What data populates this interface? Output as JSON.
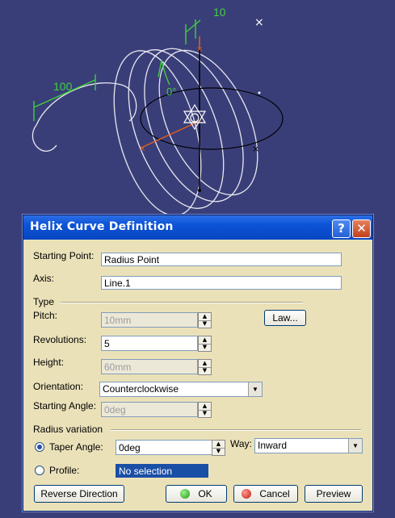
{
  "viewport": {
    "dim_pitch": "10",
    "dim_length": "100",
    "dim_angle": "0°"
  },
  "dialog": {
    "title": "Helix Curve Definition",
    "help_glyph": "?",
    "close_glyph": "✕",
    "starting_point": {
      "label": "Starting Point:",
      "value": "Radius Point"
    },
    "axis": {
      "label": "Axis:",
      "value": "Line.1"
    },
    "type_group": "Type",
    "pitch": {
      "label": "Pitch:",
      "value": "10mm"
    },
    "law_button": "Law...",
    "revolutions": {
      "label": "Revolutions:",
      "value": "5"
    },
    "height": {
      "label": "Height:",
      "value": "60mm"
    },
    "orientation": {
      "label": "Orientation:",
      "value": "Counterclockwise"
    },
    "starting_angle": {
      "label": "Starting Angle:",
      "value": "0deg"
    },
    "radius_group": "Radius variation",
    "taper_angle": {
      "label": "Taper Angle:",
      "value": "0deg",
      "selected": true
    },
    "way": {
      "label": "Way:",
      "value": "Inward"
    },
    "profile": {
      "label": "Profile:",
      "value": "No selection",
      "selected": false
    },
    "buttons": {
      "reverse": "Reverse Direction",
      "ok": "OK",
      "cancel": "Cancel",
      "preview": "Preview"
    }
  }
}
